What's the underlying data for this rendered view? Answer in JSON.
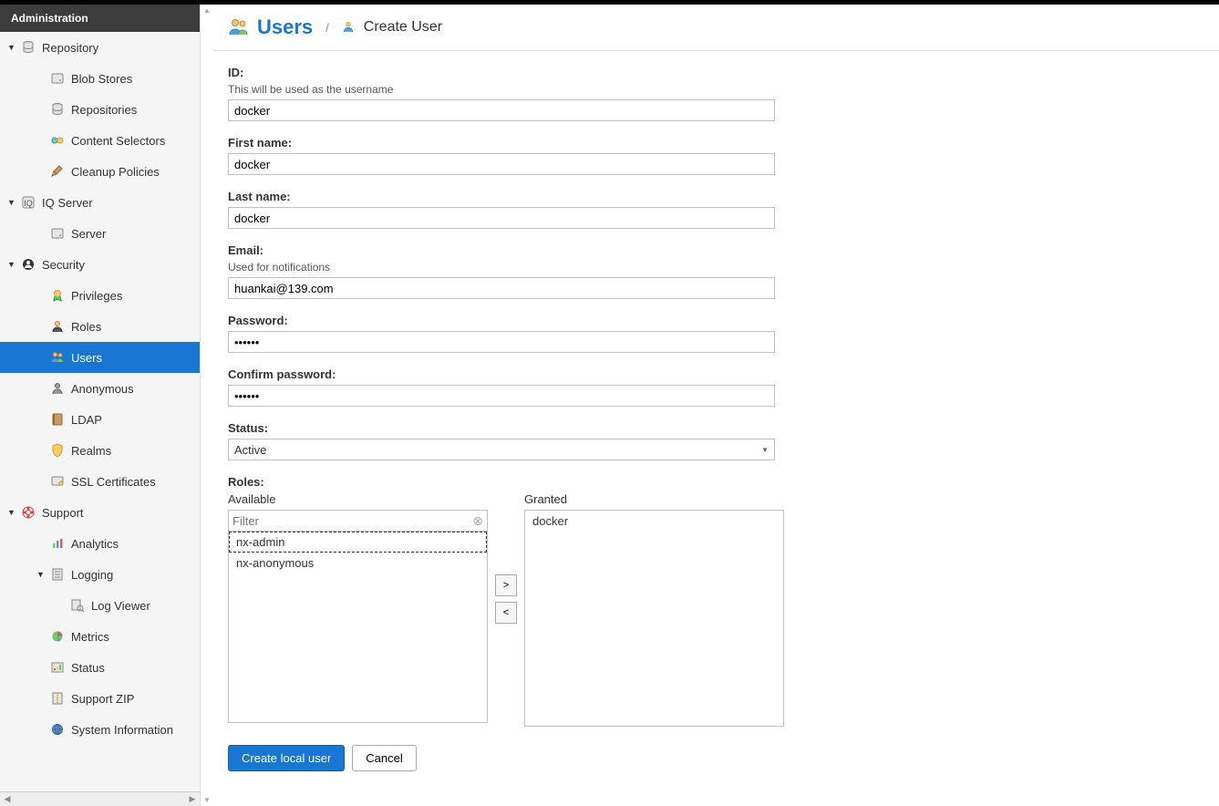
{
  "sidebar": {
    "title": "Administration",
    "sections": [
      {
        "label": "Repository",
        "icon": "database-icon",
        "expanded": true,
        "children": [
          {
            "label": "Blob Stores",
            "icon": "disk-icon"
          },
          {
            "label": "Repositories",
            "icon": "database-icon"
          },
          {
            "label": "Content Selectors",
            "icon": "tag-icon"
          },
          {
            "label": "Cleanup Policies",
            "icon": "broom-icon"
          }
        ]
      },
      {
        "label": "IQ Server",
        "icon": "iq-icon",
        "expanded": true,
        "children": [
          {
            "label": "Server",
            "icon": "disk-icon"
          }
        ]
      },
      {
        "label": "Security",
        "icon": "security-icon",
        "expanded": true,
        "children": [
          {
            "label": "Privileges",
            "icon": "ribbon-icon"
          },
          {
            "label": "Roles",
            "icon": "user-role-icon"
          },
          {
            "label": "Users",
            "icon": "users-icon",
            "active": true
          },
          {
            "label": "Anonymous",
            "icon": "anon-icon"
          },
          {
            "label": "LDAP",
            "icon": "book-icon"
          },
          {
            "label": "Realms",
            "icon": "shield-icon"
          },
          {
            "label": "SSL Certificates",
            "icon": "cert-icon"
          }
        ]
      },
      {
        "label": "Support",
        "icon": "lifebuoy-icon",
        "expanded": true,
        "children": [
          {
            "label": "Analytics",
            "icon": "chart-icon"
          },
          {
            "label": "Logging",
            "icon": "log-icon",
            "expanded": true,
            "children": [
              {
                "label": "Log Viewer",
                "icon": "logview-icon"
              }
            ]
          },
          {
            "label": "Metrics",
            "icon": "pie-icon"
          },
          {
            "label": "Status",
            "icon": "status-icon"
          },
          {
            "label": "Support ZIP",
            "icon": "zip-icon"
          },
          {
            "label": "System Information",
            "icon": "globe-icon"
          }
        ]
      }
    ]
  },
  "header": {
    "title": "Users",
    "crumb": "Create User"
  },
  "form": {
    "id": {
      "label": "ID:",
      "help": "This will be used as the username",
      "value": "docker"
    },
    "first_name": {
      "label": "First name:",
      "value": "docker"
    },
    "last_name": {
      "label": "Last name:",
      "value": "docker"
    },
    "email": {
      "label": "Email:",
      "help": "Used for notifications",
      "value": "huankai@139.com"
    },
    "password": {
      "label": "Password:",
      "value": "••••••"
    },
    "confirm_password": {
      "label": "Confirm password:",
      "value": "••••••"
    },
    "status": {
      "label": "Status:",
      "value": "Active"
    },
    "roles": {
      "label": "Roles:",
      "available_label": "Available",
      "granted_label": "Granted",
      "filter_placeholder": "Filter",
      "available": [
        {
          "name": "nx-admin",
          "selected": true
        },
        {
          "name": "nx-anonymous",
          "selected": false
        }
      ],
      "granted": [
        {
          "name": "docker"
        }
      ]
    }
  },
  "actions": {
    "create": "Create local user",
    "cancel": "Cancel"
  }
}
